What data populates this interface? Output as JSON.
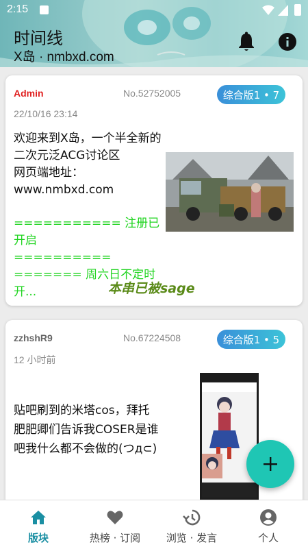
{
  "status_bar": {
    "time": "2:15"
  },
  "header": {
    "title": "时间线",
    "subtitle": "X岛 · nmbxd.com",
    "bell_icon": "bell-icon",
    "info_icon": "info-icon"
  },
  "posts": [
    {
      "user": "Admin",
      "post_no": "No.52752005",
      "badge": "综合版1 • 7",
      "date": "22/10/16 23:14",
      "body_lines": [
        "欢迎来到X岛，一个半全新的二次元泛ACG讨论区",
        "网页端地址：",
        "www.nmbxd.com"
      ],
      "green_lines": [
        "=========== 注册已开启",
        "==========",
        "======= 周六日不定时开..."
      ],
      "sage": "本串已被sage"
    },
    {
      "user": "zzhshR9",
      "post_no": "No.67224508",
      "badge": "综合版1 • 5",
      "date": "12 小时前",
      "body": "贴吧刷到的米塔cos，拜托肥肥卿们告诉我COSER是谁吧我什么都不会做的(つд⊂)"
    }
  ],
  "fab": {
    "icon": "plus-icon"
  },
  "nav": [
    {
      "label": "版块",
      "icon": "home-icon",
      "active": true
    },
    {
      "label": "热榜 · 订阅",
      "icon": "heart-icon",
      "active": false
    },
    {
      "label": "浏览 · 发言",
      "icon": "history-icon",
      "active": false
    },
    {
      "label": "个人",
      "icon": "account-icon",
      "active": false
    }
  ],
  "colors": {
    "accent": "#1a8fa3",
    "admin": "#e02020",
    "green_text": "#1fd41f",
    "sage": "#5a8a18",
    "fab": "#1fc6b4"
  }
}
